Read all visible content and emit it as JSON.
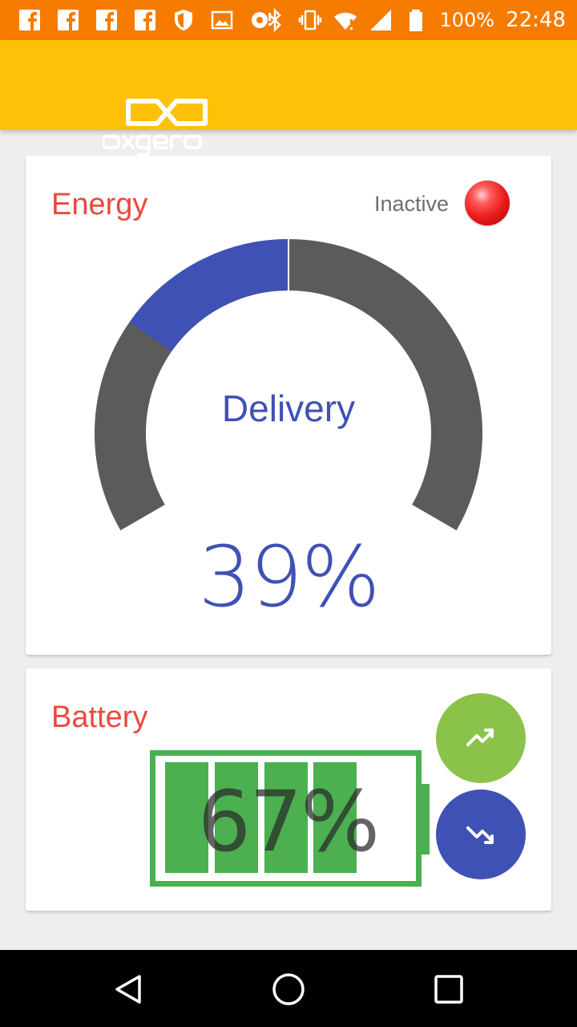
{
  "status_bar": {
    "left_icons": [
      "facebook-icon",
      "facebook-icon",
      "facebook-icon",
      "facebook-icon",
      "shield-icon",
      "image-icon",
      "sync-icon"
    ],
    "right_icons": [
      "bluetooth-icon",
      "vibrate-icon",
      "wifi-icon",
      "signal-icon",
      "battery-icon"
    ],
    "battery_percent": "100%",
    "time": "22:48"
  },
  "app_bar": {
    "logo_text": "oxgero",
    "color": "#ffc107"
  },
  "energy_card": {
    "title": "Energy",
    "status_label": "Inactive",
    "status_color": "#e81c1c",
    "gauge": {
      "label": "Delivery",
      "value_text": "39%",
      "value": 39,
      "track_color": "#5b5b5b",
      "fill_color": "#3f51b5"
    }
  },
  "battery_card": {
    "title": "Battery",
    "value_text": "67%",
    "value": 67,
    "color": "#4caf50",
    "up_button_color": "#8bc34a",
    "down_button_color": "#3f51b5"
  },
  "nav_bar": {
    "buttons": [
      "back-icon",
      "home-icon",
      "recent-apps-icon"
    ]
  }
}
